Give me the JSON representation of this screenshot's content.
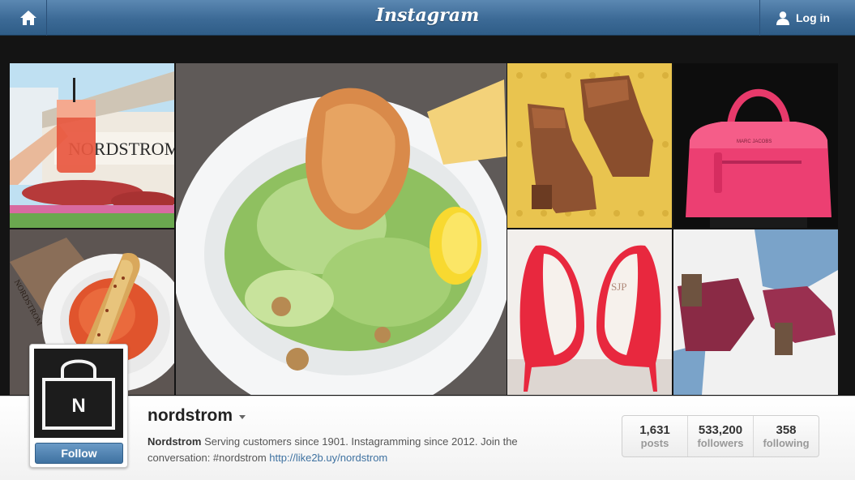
{
  "header": {
    "logo_text": "Instagram",
    "home_icon": "home-icon",
    "login_label": "Log in",
    "login_icon": "user-icon",
    "bar_color": "#3c6a96"
  },
  "photos": [
    {
      "id": "drink-at-storefront",
      "sign_text": "NORDSTROM"
    },
    {
      "id": "caesar-salad"
    },
    {
      "id": "brown-ankle-boots"
    },
    {
      "id": "pink-handbag",
      "tag_text": "MARC JACOBS"
    },
    {
      "id": "tomato-soup",
      "wrapper_text": "NORDSTROM"
    },
    {
      "id": "red-heels",
      "insole_text": "SJP"
    },
    {
      "id": "burgundy-booties"
    }
  ],
  "profile": {
    "avatar_letter": "N",
    "follow_label": "Follow",
    "username": "nordstrom",
    "bio_name": "Nordstrom",
    "bio_text": " Serving customers since 1901. Instagramming since 2012. Join the conversation: #nordstrom ",
    "bio_link": "http://like2b.uy/nordstrom",
    "accent_color": "#3f72a1"
  },
  "stats": [
    {
      "value": "1,631",
      "label": "posts"
    },
    {
      "value": "533,200",
      "label": "followers"
    },
    {
      "value": "358",
      "label": "following"
    }
  ]
}
